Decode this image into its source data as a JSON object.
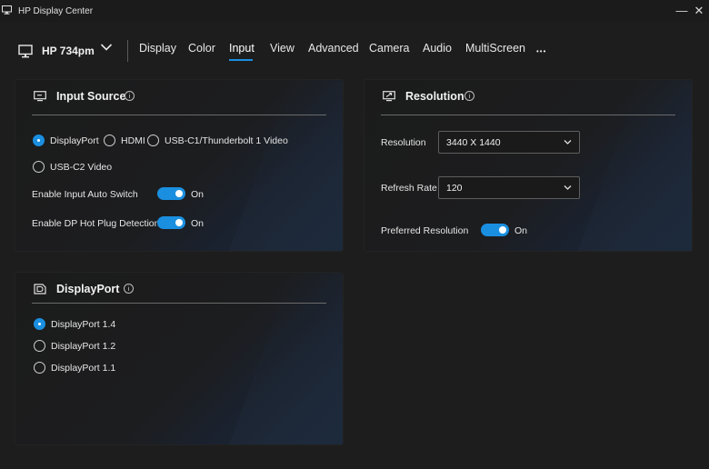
{
  "window": {
    "title": "HP Display Center",
    "minimize_glyph": "—",
    "close_glyph": "✕"
  },
  "nav": {
    "monitor_name": "HP 734pm",
    "tabs": [
      "Display",
      "Color",
      "Input",
      "View",
      "Advanced",
      "Camera",
      "Audio",
      "MultiScreen"
    ],
    "active_tab": "Input",
    "more_glyph": "•••"
  },
  "input_source": {
    "title": "Input Source",
    "info_glyph": "i",
    "options": [
      "DisplayPort",
      "HDMI",
      "USB-C1/Thunderbolt 1 Video",
      "USB-C2 Video"
    ],
    "selected": "DisplayPort",
    "auto_switch_label": "Enable Input Auto Switch",
    "auto_switch_value": "On",
    "hot_plug_label": "Enable DP Hot Plug Detection",
    "hot_plug_value": "On"
  },
  "resolution": {
    "title": "Resolution",
    "info_glyph": "i",
    "resolution_label": "Resolution",
    "resolution_value": "3440 X 1440",
    "refresh_label": "Refresh Rate",
    "refresh_value": "120",
    "preferred_label": "Preferred Resolution",
    "preferred_value": "On"
  },
  "displayport": {
    "title": "DisplayPort",
    "info_glyph": "i",
    "options": [
      "DisplayPort 1.4",
      "DisplayPort 1.2",
      "DisplayPort 1.1"
    ],
    "selected": "DisplayPort 1.4"
  },
  "colors": {
    "accent": "#1a8fe0",
    "background": "#1d1d1d",
    "panel": "#1b1b1b"
  }
}
